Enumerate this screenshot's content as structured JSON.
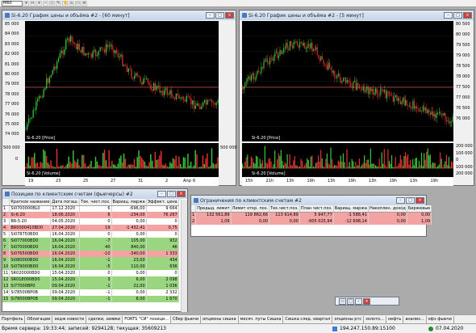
{
  "toolbar": {
    "period_select": "M60"
  },
  "chart1": {
    "title": "Si-6.20 График цены и объёма #2 - [60 минут]",
    "price_label": "Si-6.20 [Price]",
    "volume_label": "Si-6.20 [Volume]",
    "price_ticks": [
      "85 000",
      "84 000",
      "83 000",
      "82 000",
      "81 000",
      "80 000",
      "79 000",
      "78 000",
      "77 000",
      "76 000",
      "75 000",
      "74 000"
    ],
    "volume_ticks": [
      "500 000",
      "0",
      "500 000"
    ],
    "date_ticks": [
      "19",
      "23",
      "25",
      "27",
      "31",
      "2",
      "6"
    ],
    "month_label": "Апр"
  },
  "chart2": {
    "title": "Si-6.20 График цены и объёма #2 - [5 минут]",
    "price_label": "Si-6.20 [Price]",
    "volume_label": "Si-6.20 [Volume]",
    "price_ticks": [
      "80 500",
      "80 000",
      "79 500",
      "79 000",
      "78 500",
      "78 000",
      "77 500",
      "77 000",
      "76 500",
      "76 000"
    ],
    "volume_ticks": [
      "200 000",
      "100 000",
      "0",
      "100 000",
      "200 000"
    ],
    "time_ticks": [
      "15h",
      "21h",
      "13h",
      "19h",
      "13h",
      "19h",
      "13h",
      "19h",
      "13h",
      "19h"
    ]
  },
  "positions": {
    "title": "Позиции по клиентским счетам (фьючерсы) #2",
    "columns": [
      "",
      "Краткое название",
      "Дата погаш.",
      "Тек. чист.поз.",
      "Вариац. маржа",
      "Эффект. цена"
    ],
    "rows": [
      {
        "n": "1",
        "name": "Si0700000BL0",
        "date": "17.12.2020",
        "pos": "6",
        "margin": "-696,00",
        "price": "9 664",
        "color": "white"
      },
      {
        "n": "2",
        "name": "Si-6.20",
        "date": "18.06.2020",
        "pos": "6",
        "margin": "-234,00",
        "price": "76 267",
        "color": "red"
      },
      {
        "n": "3",
        "name": "BR-5.20",
        "date": "04.05.2020",
        "pos": "0",
        "margin": "0,00",
        "price": "0",
        "color": "white"
      },
      {
        "n": "4",
        "name": "BR0000410BD0",
        "date": "27.04.2020",
        "pos": "19",
        "margin": "-1 432,41",
        "price": "0,75",
        "color": "red"
      },
      {
        "n": "5",
        "name": "Si078750BD0",
        "date": "16.04.2020",
        "pos": "0",
        "margin": "0,00",
        "price": "0",
        "color": "white"
      },
      {
        "n": "6",
        "name": "Si077000BD0",
        "date": "16.04.2020",
        "pos": "-7",
        "margin": "105,00",
        "price": "932",
        "color": "green"
      },
      {
        "n": "7",
        "name": "Si070000BD0",
        "date": "16.04.2020",
        "pos": "40",
        "margin": "840,00",
        "price": "46",
        "color": "green"
      },
      {
        "n": "8",
        "name": "Si076500BD0",
        "date": "16.04.2020",
        "pos": "-10",
        "margin": "-340,00",
        "price": "1 333",
        "color": "red"
      },
      {
        "n": "9",
        "name": "Si080000BD0",
        "date": "16.04.2020",
        "pos": "-1",
        "margin": "23,00",
        "price": "434",
        "color": "green"
      },
      {
        "n": "10",
        "name": "Si079000BD0",
        "date": "16.04.2020",
        "pos": "-5",
        "margin": "110,00",
        "price": "636",
        "color": "green"
      },
      {
        "n": "11",
        "name": "SR020000BD0",
        "date": "15.04.2020",
        "pos": "0",
        "margin": "0,00",
        "price": "0",
        "color": "white"
      },
      {
        "n": "12",
        "name": "SR018000BD0",
        "date": "15.04.2020",
        "pos": "3",
        "margin": "6,00",
        "price": "2 098",
        "color": "green"
      },
      {
        "n": "13",
        "name": "Si77000BP0",
        "date": "09.04.2020",
        "pos": "-1",
        "margin": "22,00",
        "price": "1 036",
        "color": "green"
      },
      {
        "n": "14",
        "name": "Si78500BP0B",
        "date": "09.04.2020",
        "pos": "-1",
        "margin": "0,00",
        "price": "2 332",
        "color": "white"
      },
      {
        "n": "15",
        "name": "Si78000BP0B",
        "date": "09.04.2020",
        "pos": "-1",
        "margin": "8,00",
        "price": "1 870",
        "color": "green"
      }
    ]
  },
  "limits": {
    "title": "Ограничения по клиентским счетам #2",
    "columns": [
      "",
      "Предыд. лимит",
      "Лимит откр. поз.",
      "Тек.чист.поз.",
      "План чист.поз.",
      "Вариац. маржа",
      "Накоплен. доход",
      "Биржевые"
    ],
    "rows": [
      {
        "n": "1",
        "prev": "132 561,89",
        "open": "119 862,66",
        "cur": "113 914,89",
        "plan": "5 947,77",
        "margin": "-1 588,41",
        "accum": "0,00",
        "fees": "0,00",
        "color": "red"
      },
      {
        "n": "2",
        "prev": "1,09",
        "open": "0,00",
        "cur": "0,00",
        "plan": "-905 025,94",
        "margin": "-12 698,14",
        "accum": "0,00",
        "fees": "1,09",
        "color": "red"
      }
    ]
  },
  "tabs": [
    "Портфель",
    "Облигации",
    "хедж новости",
    "сделки, заявки",
    "FORTS \"СИ\" позици...",
    "Сбер фьючи",
    "опционы сишка",
    "месяч. путы Сишка",
    "Сишка след. квартал",
    "опционы ртс",
    "золото...",
    "нефть",
    "анализ...",
    "офз фьючи"
  ],
  "active_tab": 4,
  "status": {
    "server_time": "Время сервера: 19:33:44; записей: 9294128; текущая: 35609213",
    "ip": "194.247.150.89:15100",
    "date": "07.04.2020"
  },
  "colors": {
    "up": "#39c43b",
    "down": "#e03030",
    "bg": "#000000",
    "level": "#c04848"
  }
}
